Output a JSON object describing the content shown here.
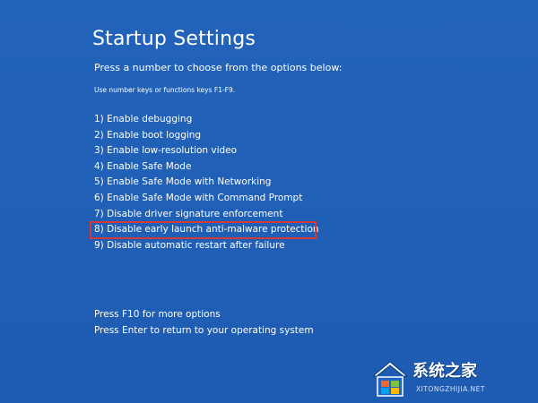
{
  "screen": {
    "title": "Startup Settings",
    "prompt": "Press a number to choose from the options below:",
    "hint": "Use number keys or functions keys F1-F9.",
    "options": [
      "1) Enable debugging",
      "2) Enable boot logging",
      "3) Enable low-resolution video",
      "4) Enable Safe Mode",
      "5) Enable Safe Mode with Networking",
      "6) Enable Safe Mode with Command Prompt",
      "7) Disable driver signature enforcement",
      "8) Disable early launch anti-malware protection",
      "9) Disable automatic restart after failure"
    ],
    "highlighted_option_index": 7,
    "footer": [
      "Press F10 for more options",
      "Press Enter to return to your operating system"
    ]
  },
  "colors": {
    "background": "#2061b8",
    "text": "#ffffff",
    "highlight_border": "#d23a3a"
  },
  "watermark": {
    "text": "系统之家",
    "url": "XITONGZHIJIA.NET",
    "icon": "windows-house-logo-icon"
  }
}
